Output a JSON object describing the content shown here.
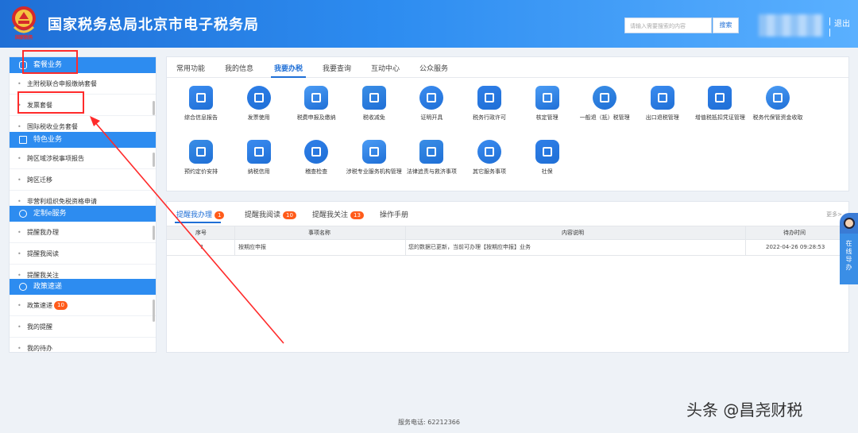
{
  "header": {
    "emblem_caption": "国家税务",
    "title": "国家税务总局北京市电子税务局",
    "search_placeholder": "请输入需要搜索的内容",
    "search_button": "搜索",
    "logout": "退出"
  },
  "sidebar": {
    "sections": [
      {
        "title": "套餐业务",
        "icon": "package-icon",
        "items": [
          "主附税联合申报缴纳套餐",
          "发票套餐",
          "国际税收业务套餐"
        ]
      },
      {
        "title": "特色业务",
        "icon": "grid-icon",
        "items": [
          "跨区域涉税事项报告",
          "跨区迁移",
          "非营利组织免税资格申请"
        ]
      },
      {
        "title": "定制e服务",
        "icon": "user-icon",
        "items": [
          "提醒我办理",
          "提醒我阅读",
          "提醒我关注"
        ]
      },
      {
        "title": "政策速递",
        "icon": "user-icon",
        "items": [
          "政策速递",
          "我的提醒",
          "我的待办"
        ],
        "badge": "10"
      }
    ]
  },
  "main": {
    "tabs": [
      "常用功能",
      "我的信息",
      "我要办税",
      "我要查询",
      "互动中心",
      "公众服务"
    ],
    "active_tab": "我要办税",
    "functions": [
      {
        "label": "综合信息报告",
        "icon": "report-icon"
      },
      {
        "label": "发票使用",
        "icon": "invoice-icon"
      },
      {
        "label": "税费申报及缴纳",
        "icon": "tax-payment-icon"
      },
      {
        "label": "税收减免",
        "icon": "tax-relief-icon"
      },
      {
        "label": "证明开具",
        "icon": "certificate-icon"
      },
      {
        "label": "税务行政许可",
        "icon": "license-icon"
      },
      {
        "label": "核定管理",
        "icon": "verify-icon"
      },
      {
        "label": "一般退（抵）税管理",
        "icon": "refund-icon"
      },
      {
        "label": "出口退税管理",
        "icon": "export-refund-icon"
      },
      {
        "label": "增值税抵扣凭证管理",
        "icon": "vat-deduction-icon"
      },
      {
        "label": "税务代保管资金收取",
        "icon": "custody-fund-icon"
      },
      {
        "label": "预约定价安排",
        "icon": "pricing-icon"
      },
      {
        "label": "纳税信用",
        "icon": "credit-icon"
      },
      {
        "label": "稽查检查",
        "icon": "inspection-icon"
      },
      {
        "label": "涉税专业服务机构管理",
        "icon": "agency-icon"
      },
      {
        "label": "法律追责与救济事项",
        "icon": "law-icon"
      },
      {
        "label": "其它服务事项",
        "icon": "other-service-icon"
      },
      {
        "label": "社保",
        "icon": "social-security-icon"
      }
    ]
  },
  "reminders": {
    "tabs": [
      {
        "label": "提醒我办理",
        "badge": "1"
      },
      {
        "label": "提醒我阅读",
        "badge": "10"
      },
      {
        "label": "提醒我关注",
        "badge": "13"
      },
      {
        "label": "操作手册",
        "badge": ""
      }
    ],
    "more": "更多>",
    "columns": [
      "序号",
      "事项名称",
      "内容说明",
      "待办时间"
    ],
    "rows": [
      {
        "index": "1",
        "name": "按期应申报",
        "desc": "您的数据已更新，当前可办理【按期应申报】业务",
        "time": "2022-04-26 09:28:53"
      }
    ]
  },
  "float_service": {
    "label": "在线导办"
  },
  "footer": {
    "service_phone": "服务电话: 62212366"
  },
  "watermark": "头条 @昌尧财税",
  "colors": {
    "primary": "#2d8cf0",
    "header": "#1f6fd6",
    "badge": "#ff5b1a",
    "annotation": "#ff2b2b"
  }
}
